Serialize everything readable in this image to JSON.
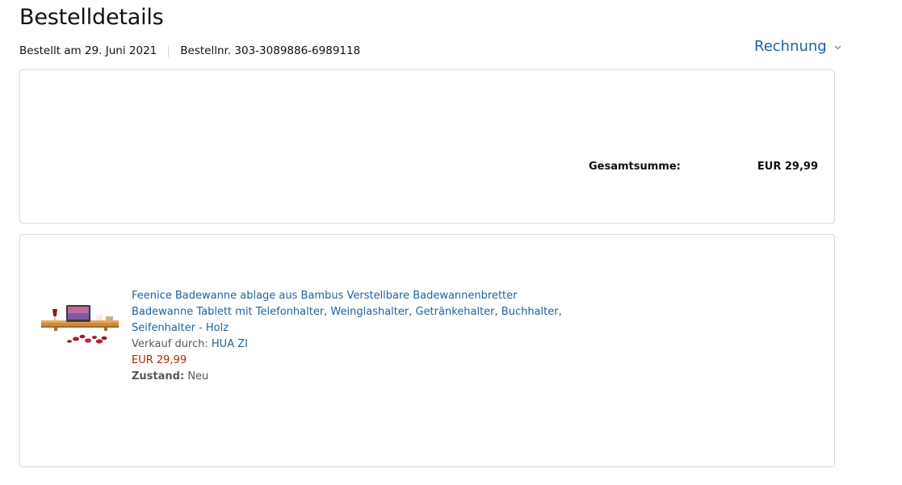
{
  "header": {
    "title": "Bestelldetails",
    "order_date": "Bestellt am 29. Juni 2021",
    "order_number": "Bestellnr. 303-3089886-6989118",
    "invoice_label": "Rechnung"
  },
  "summary": {
    "total_label": "Gesamtsumme:",
    "total_value": "EUR 29,99"
  },
  "item": {
    "title": "Feenice Badewanne ablage aus Bambus Verstellbare Badewannenbretter Badewanne Tablett mit Telefonhalter, Weinglashalter, Getränkehalter, Buchhalter, Seifenhalter - Holz",
    "seller_prefix": "Verkauf durch:",
    "seller_name": "HUA ZI",
    "price": "EUR 29,99",
    "condition_label": "Zustand:",
    "condition_value": "Neu",
    "image_icon": "bamboo-bath-tray-product-image"
  },
  "colors": {
    "link": "#2162a1",
    "price": "#b12704",
    "border": "#d5d9d9",
    "text": "#0f1111",
    "secondary_text": "#565959"
  }
}
